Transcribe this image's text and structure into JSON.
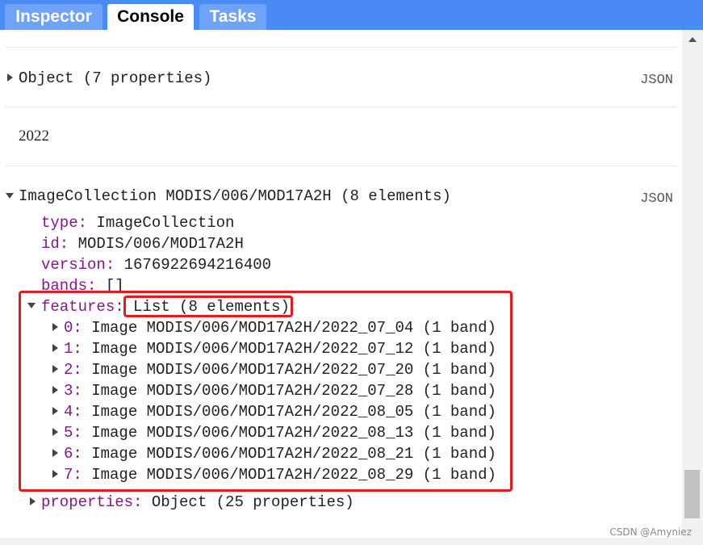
{
  "tabs": [
    {
      "label": "Inspector",
      "active": false
    },
    {
      "label": "Console",
      "active": true
    },
    {
      "label": "Tasks",
      "active": false
    }
  ],
  "console": {
    "entry1": {
      "label": "Object (7 properties)",
      "json_link": "JSON"
    },
    "entry2": {
      "text": "2022"
    },
    "entry3": {
      "header": "ImageCollection MODIS/006/MOD17A2H (8 elements)",
      "json_link": "JSON",
      "props": [
        {
          "key": "type:",
          "value": "ImageCollection"
        },
        {
          "key": "id:",
          "value": "MODIS/006/MOD17A2H"
        },
        {
          "key": "version:",
          "value": "1676922694216400"
        },
        {
          "key": "bands:",
          "value": "[]"
        }
      ],
      "features_key": "features:",
      "features_value": "List (8 elements)",
      "features": [
        {
          "index": "0:",
          "value": "Image MODIS/006/MOD17A2H/2022_07_04 (1 band)"
        },
        {
          "index": "1:",
          "value": "Image MODIS/006/MOD17A2H/2022_07_12 (1 band)"
        },
        {
          "index": "2:",
          "value": "Image MODIS/006/MOD17A2H/2022_07_20 (1 band)"
        },
        {
          "index": "3:",
          "value": "Image MODIS/006/MOD17A2H/2022_07_28 (1 band)"
        },
        {
          "index": "4:",
          "value": "Image MODIS/006/MOD17A2H/2022_08_05 (1 band)"
        },
        {
          "index": "5:",
          "value": "Image MODIS/006/MOD17A2H/2022_08_13 (1 band)"
        },
        {
          "index": "6:",
          "value": "Image MODIS/006/MOD17A2H/2022_08_21 (1 band)"
        },
        {
          "index": "7:",
          "value": "Image MODIS/006/MOD17A2H/2022_08_29 (1 band)"
        }
      ],
      "properties_key": "properties:",
      "properties_value": "Object (25 properties)"
    }
  },
  "watermark": "CSDN @Amyniez",
  "colors": {
    "tabbar": "#4a8af4",
    "key": "#881391",
    "highlight": "#e8191d"
  }
}
